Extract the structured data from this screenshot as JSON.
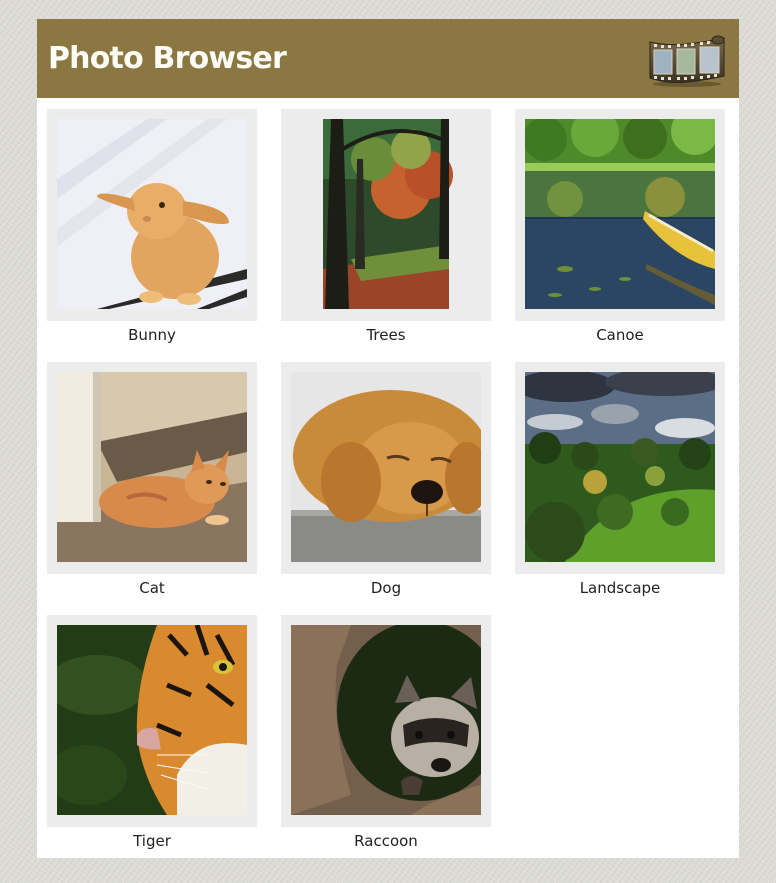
{
  "header": {
    "title": "Photo Browser",
    "icon": "film-strip-icon"
  },
  "photos": [
    {
      "label": "Bunny",
      "icon": "bunny-photo"
    },
    {
      "label": "Trees",
      "icon": "trees-photo"
    },
    {
      "label": "Canoe",
      "icon": "canoe-photo"
    },
    {
      "label": "Cat",
      "icon": "cat-photo"
    },
    {
      "label": "Dog",
      "icon": "dog-photo"
    },
    {
      "label": "Landscape",
      "icon": "landscape-photo"
    },
    {
      "label": "Tiger",
      "icon": "tiger-photo"
    },
    {
      "label": "Raccoon",
      "icon": "raccoon-photo"
    }
  ],
  "colors": {
    "header_bg": "#8b7741",
    "page_bg": "#dcdbd6",
    "frame_bg": "#ececec"
  }
}
